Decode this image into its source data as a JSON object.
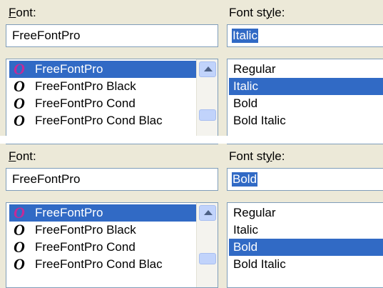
{
  "panels": [
    {
      "font_label_hot": "F",
      "font_label_rest": "ont:",
      "style_label_a": "Font st",
      "style_label_hot": "y",
      "style_label_b": "le:",
      "font_value": "FreeFontPro",
      "style_value": "Italic",
      "font_items": [
        {
          "glyph": "O",
          "label": "FreeFontPro"
        },
        {
          "glyph": "O",
          "label": "FreeFontPro Black"
        },
        {
          "glyph": "O",
          "label": "FreeFontPro Cond"
        },
        {
          "glyph": "O",
          "label": "FreeFontPro Cond Blac"
        }
      ],
      "style_items": [
        "Regular",
        "Italic",
        "Bold",
        "Bold Italic"
      ],
      "selected_font": "FreeFontPro",
      "selected_style": "Italic"
    },
    {
      "font_label_hot": "F",
      "font_label_rest": "ont:",
      "style_label_a": "Font st",
      "style_label_hot": "y",
      "style_label_b": "le:",
      "font_value": "FreeFontPro",
      "style_value": "Bold",
      "font_items": [
        {
          "glyph": "O",
          "label": "FreeFontPro"
        },
        {
          "glyph": "O",
          "label": "FreeFontPro Black"
        },
        {
          "glyph": "O",
          "label": "FreeFontPro Cond"
        },
        {
          "glyph": "O",
          "label": "FreeFontPro Cond Blac"
        }
      ],
      "style_items": [
        "Regular",
        "Italic",
        "Bold",
        "Bold Italic"
      ],
      "selected_font": "FreeFontPro",
      "selected_style": "Bold"
    }
  ],
  "colors": {
    "selection": "#316ac5",
    "selected_glyph": "#c42a97",
    "dialog_bg": "#ece9d8",
    "field_border": "#7f9db9"
  },
  "icons": {
    "font_glyph": "opentype-font-icon",
    "scroll_up": "scroll-up-arrow-icon",
    "scroll_thumb": "scrollbar-thumb"
  }
}
